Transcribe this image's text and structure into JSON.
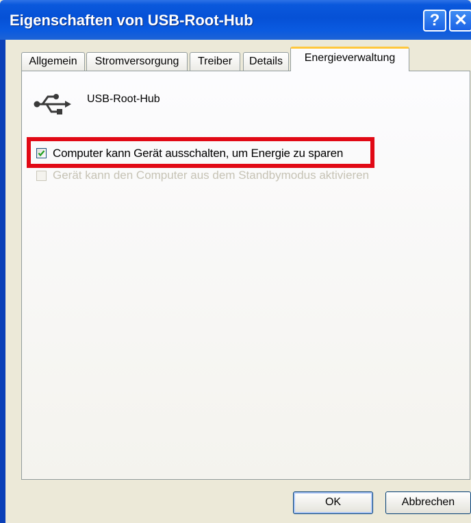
{
  "window": {
    "title": "Eigenschaften von USB-Root-Hub",
    "help_symbol": "?",
    "close_symbol": "✕"
  },
  "tabs": [
    {
      "label": "Allgemein",
      "active": false
    },
    {
      "label": "Stromversorgung",
      "active": false
    },
    {
      "label": "Treiber",
      "active": false
    },
    {
      "label": "Details",
      "active": false
    },
    {
      "label": "Energieverwaltung",
      "active": true
    }
  ],
  "device": {
    "icon": "usb-icon",
    "name": "USB-Root-Hub"
  },
  "options": [
    {
      "label": "Computer kann Gerät ausschalten, um Energie zu sparen",
      "checked": true,
      "enabled": true,
      "highlighted": true
    },
    {
      "label": "Gerät kann den Computer aus dem Standbymodus aktivieren",
      "checked": false,
      "enabled": false,
      "highlighted": false
    }
  ],
  "buttons": {
    "ok": "OK",
    "cancel": "Abbrechen"
  },
  "colors": {
    "title_bar": "#0651D6",
    "highlight_border": "#E10915",
    "active_tab_accent": "#FFC73C",
    "dialog_background": "#ECE9D8"
  }
}
